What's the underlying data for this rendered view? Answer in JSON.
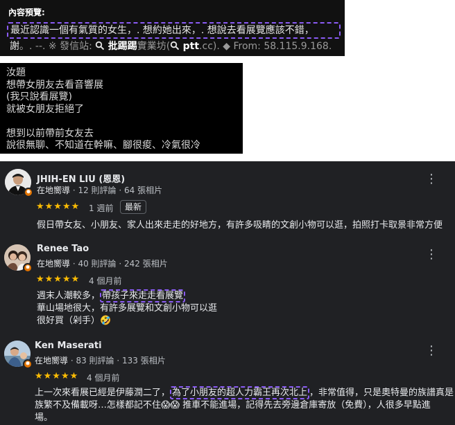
{
  "preview": {
    "label": "內容預覽:",
    "line1": "最近認識一個有氣質的女生，. 想約她出來，. 想說去看展覽應該不錯，",
    "line2_a": "謝",
    "line2_b": "。. --. ※ 發信站: ",
    "line2_c": "批踢踢",
    "line2_d": "實業坊(",
    "line2_e": "ptt",
    "line2_f": ".cc). ◆ From: 58.115.9.168."
  },
  "post": {
    "body": "汝題\n想帶女朋友去看音響展\n(我只說看展覽)\n就被女朋友拒絕了\n\n想到以前帶前女友去\n說很無聊、不知道在幹嘛、腳很痠、冷氣很冷"
  },
  "reviews": [
    {
      "name": "JHIH-EN LIU (恩恩)",
      "guide": "在地嚮導",
      "stats": " · 12 則評論 · 64 張相片",
      "stars": "★★★★★",
      "when": "1 週前",
      "badge": "最新",
      "text1": "假日帶女友、小朋友、家人出來走走的好地方，有許多吸睛的文創小物可以逛，拍照打卡取景非常方便"
    },
    {
      "name": "Renee Tao",
      "guide": "在地嚮導",
      "stats": " · 40 則評論 · 242 張相片",
      "stars": "★★★★★",
      "when": "4 個月前",
      "text1_a": "週末人潮較多，",
      "text1_b": "帶孩子來走走看展覽",
      "text2": "華山場地很大，有許多展覽和文創小物可以逛",
      "text3": "很好買（剁手）🤣"
    },
    {
      "name": "Ken Maserati",
      "guide": "在地嚮導",
      "stats": " · 83 則評論 · 133 張相片",
      "stars": "★★★★★",
      "when": "4 個月前",
      "text1_a": "上一次來看展已經是伊藤潤二了，",
      "text1_b": "為了小朋友的超人力霸王再次北上",
      "text1_c": "，非常值得，只是奧特曼的族譜真是",
      "text2": "族繁不及備載呀…怎樣都記不住😱😱 推車不能進場，記得先去旁邊倉庫寄放（免費），人很多早點進",
      "text3": "場。"
    }
  ],
  "icons": {
    "more": "more-vert-icon",
    "search": "search-icon",
    "guide_badge": "local-guide-badge-icon"
  },
  "colors": {
    "accent_dash": "#8b5cf6",
    "stars": "#fbbc04",
    "badge": "#e37400"
  }
}
